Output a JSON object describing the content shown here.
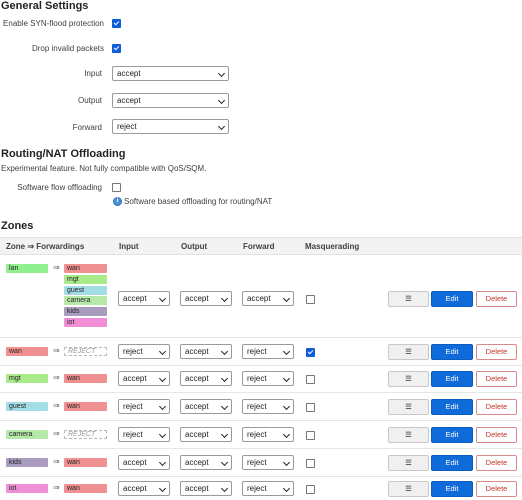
{
  "general": {
    "title": "General Settings",
    "syn_label": "Enable SYN-flood protection",
    "syn_checked": true,
    "drop_label": "Drop invalid packets",
    "drop_checked": true,
    "input_label": "Input",
    "input_value": "accept",
    "output_label": "Output",
    "output_value": "accept",
    "forward_label": "Forward",
    "forward_value": "reject"
  },
  "offload": {
    "title": "Routing/NAT Offloading",
    "note": "Experimental feature. Not fully compatible with QoS/SQM.",
    "flow_label": "Software flow offloading",
    "flow_checked": false,
    "flow_hint": "Software based offloading for routing/NAT"
  },
  "zones": {
    "title": "Zones",
    "headers": {
      "zone": "Zone ⇒ Forwardings",
      "input": "Input",
      "output": "Output",
      "forward": "Forward",
      "masq": "Masquerading"
    },
    "buttons": {
      "menu": "☰",
      "edit": "Edit",
      "delete": "Delete"
    },
    "rows": [
      {
        "name": "lan",
        "color": "#90f090",
        "forwards": [
          {
            "name": "wan",
            "color": "#f09090"
          },
          {
            "name": "mgt",
            "color": "#a9ea8b"
          },
          {
            "name": "guest",
            "color": "#a3dde6"
          },
          {
            "name": "camera",
            "color": "#b6e8a8"
          },
          {
            "name": "kids",
            "color": "#a99cbf"
          },
          {
            "name": "iot",
            "color": "#f08fd6"
          }
        ],
        "input": "accept",
        "output": "accept",
        "forward": "accept",
        "masq": false
      },
      {
        "name": "wan",
        "color": "#f09090",
        "forwards": [
          {
            "name": "REJECT",
            "empty": true
          }
        ],
        "input": "reject",
        "output": "accept",
        "forward": "reject",
        "masq": true
      },
      {
        "name": "mgt",
        "color": "#a9ea8b",
        "forwards": [
          {
            "name": "wan",
            "color": "#f09090"
          }
        ],
        "input": "accept",
        "output": "accept",
        "forward": "reject",
        "masq": false
      },
      {
        "name": "guest",
        "color": "#a3dde6",
        "forwards": [
          {
            "name": "wan",
            "color": "#f09090"
          }
        ],
        "input": "reject",
        "output": "accept",
        "forward": "reject",
        "masq": false
      },
      {
        "name": "camera",
        "color": "#b6e8a8",
        "forwards": [
          {
            "name": "REJECT",
            "empty": true
          }
        ],
        "input": "reject",
        "output": "accept",
        "forward": "reject",
        "masq": false
      },
      {
        "name": "kids",
        "color": "#a99cbf",
        "forwards": [
          {
            "name": "wan",
            "color": "#f09090"
          }
        ],
        "input": "accept",
        "output": "accept",
        "forward": "reject",
        "masq": false
      },
      {
        "name": "iot",
        "color": "#f08fd6",
        "forwards": [
          {
            "name": "wan",
            "color": "#f09090"
          }
        ],
        "input": "accept",
        "output": "accept",
        "forward": "reject",
        "masq": false
      }
    ]
  }
}
